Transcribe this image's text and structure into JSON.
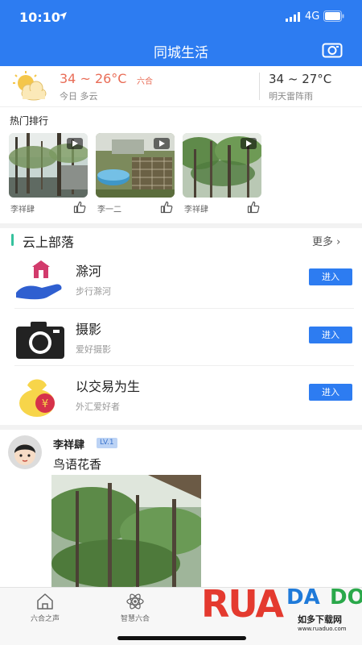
{
  "status_bar": {
    "time": "10:10",
    "network": "4G"
  },
  "nav": {
    "title": "同城生活",
    "camera_icon": "camera-icon"
  },
  "weather": {
    "today_temp": "34 ~ 26°C",
    "location": "六合",
    "today_desc": "今日  多云",
    "tomorrow_temp": "34 ~ 27°C",
    "tomorrow_desc": "明天雷阵雨",
    "icon": "partly-cloudy-icon",
    "accent": "#e96d57"
  },
  "hot": {
    "heading": "热门排行",
    "items": [
      {
        "author": "李祥肆"
      },
      {
        "author": "李一二"
      },
      {
        "author": "李祥肆"
      }
    ]
  },
  "tribe": {
    "heading": "云上部落",
    "more": "更多 ›",
    "items": [
      {
        "name": "滁河",
        "subtitle": "步行滁河",
        "button": "进入",
        "icon": "river-hand-icon"
      },
      {
        "name": "摄影",
        "subtitle": "爱好摄影",
        "button": "进入",
        "icon": "camera-icon"
      },
      {
        "name": "以交易为生",
        "subtitle": "外汇爱好者",
        "button": "进入",
        "icon": "money-bag-icon"
      }
    ]
  },
  "post": {
    "username": "李祥肆",
    "level": "LV.1",
    "text": "鸟语花香"
  },
  "tabbar": {
    "tabs": [
      {
        "label": "六合之声",
        "icon": "home-icon"
      },
      {
        "label": "智慧六合",
        "icon": "atom-icon"
      }
    ]
  },
  "watermark": {
    "brand_left": "RUA",
    "brand_mid": "DA",
    "brand_right": "DO",
    "cn": "如多下载网",
    "url": "www.ruaduo.com"
  },
  "colors": {
    "primary": "#2d7cf1",
    "green_bar": "#35c29d"
  }
}
